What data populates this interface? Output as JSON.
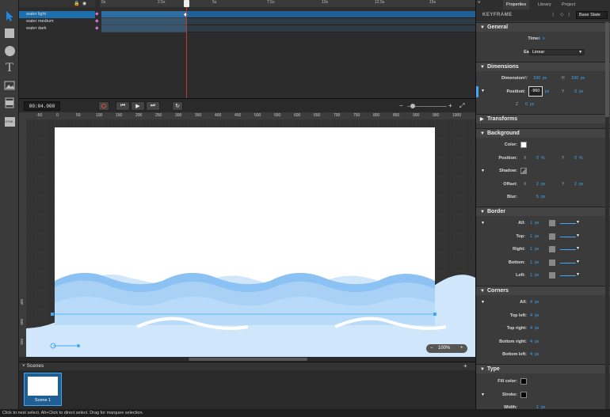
{
  "timeline": {
    "layers": [
      {
        "name": "water light",
        "selected": true
      },
      {
        "name": "water medium",
        "selected": false
      },
      {
        "name": "water dark",
        "selected": false
      }
    ],
    "ticks": [
      "0s",
      "2.5s",
      "5s",
      "7.5s",
      "10s",
      "12.5s",
      "15s"
    ],
    "time": "00:04.000"
  },
  "stage": {
    "ruler_ticks": [
      "-50",
      "0",
      "50",
      "100",
      "150",
      "200",
      "250",
      "300",
      "350",
      "400",
      "450",
      "500",
      "550",
      "600",
      "650",
      "700",
      "750",
      "800",
      "850",
      "900",
      "950",
      "1000"
    ],
    "vruler_ticks": [
      "450",
      "500",
      "550"
    ],
    "zoom": "100%",
    "colors": {
      "canvas": "#ffffff",
      "wave_light": "#cfe6fb",
      "wave_mid": "#a9d1f6",
      "wave_dark": "#8cc2f3",
      "selection": "#3fa9f5"
    }
  },
  "scenes": {
    "header": "Scenes",
    "items": [
      "Scene 1"
    ]
  },
  "status": "Click to nest select. Alt+Click to direct select. Drag for marquee selection.",
  "panel": {
    "tabs": [
      "Properties",
      "Library",
      "Project"
    ],
    "keyframe_label": "KEYFRAME",
    "base_state": "Base State",
    "general": {
      "title": "General",
      "time_label": "Time:",
      "time_val": "4",
      "time_unit": "s",
      "easing_label": "Easing:",
      "easing_val": "Linear"
    },
    "dimensions": {
      "title": "Dimensions",
      "dim_label": "Dimension:",
      "w": "W",
      "w_val": "100",
      "w_unit": "px",
      "h": "H",
      "h_val": "100",
      "h_unit": "px",
      "pos_label": "Position:",
      "x": "X",
      "x_val": "-960",
      "x_unit": "px",
      "y": "Y",
      "y_val": "0",
      "y_unit": "px",
      "z": "Z",
      "z_val": "0",
      "z_unit": "px"
    },
    "transforms": {
      "title": "Transforms"
    },
    "background": {
      "title": "Background",
      "color_label": "Color:",
      "pos_label": "Position:",
      "x": "X",
      "x_val": "0",
      "x_unit": "%",
      "y": "Y",
      "y_val": "0",
      "y_unit": "%",
      "shadow_label": "Shadow:",
      "offset_label": "Offset:",
      "ox": "X",
      "ox_val": "2",
      "ox_unit": "px",
      "oy": "Y",
      "oy_val": "2",
      "oy_unit": "px",
      "blur_label": "Blur:",
      "blur_val": "5",
      "blur_unit": "px"
    },
    "border": {
      "title": "Border",
      "rows": [
        {
          "label": "All:",
          "val": "1",
          "unit": "px"
        },
        {
          "label": "Top:",
          "val": "1",
          "unit": "px"
        },
        {
          "label": "Right:",
          "val": "1",
          "unit": "px"
        },
        {
          "label": "Bottom:",
          "val": "1",
          "unit": "px"
        },
        {
          "label": "Left:",
          "val": "1",
          "unit": "px"
        }
      ]
    },
    "corners": {
      "title": "Corners",
      "rows": [
        {
          "label": "All:",
          "val": "4",
          "unit": "px"
        },
        {
          "label": "Top left:",
          "val": "4",
          "unit": "px"
        },
        {
          "label": "Top right:",
          "val": "4",
          "unit": "px"
        },
        {
          "label": "Bottom right:",
          "val": "4",
          "unit": "px"
        },
        {
          "label": "Bottom left:",
          "val": "4",
          "unit": "px"
        }
      ]
    },
    "type": {
      "title": "Type",
      "fill_label": "Fill color:",
      "stroke_label": "Stroke:",
      "width_label": "Width:",
      "width_val": "1",
      "width_unit": "px"
    }
  }
}
